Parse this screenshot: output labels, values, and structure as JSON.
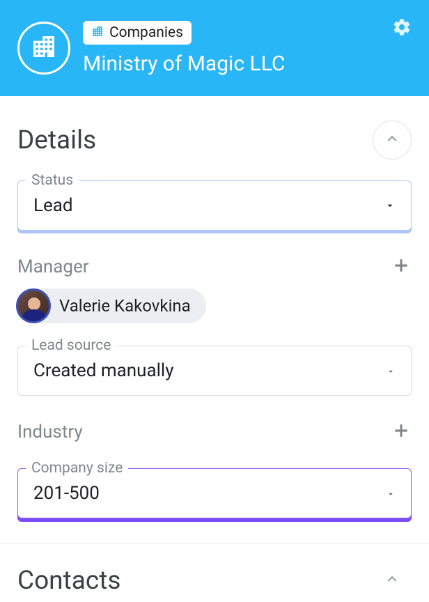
{
  "header": {
    "breadcrumb_label": "Companies",
    "company_name": "Ministry of Magic LLC"
  },
  "details": {
    "section_title": "Details",
    "status": {
      "label": "Status",
      "value": "Lead"
    },
    "manager": {
      "label": "Manager",
      "person_name": "Valerie Kakovkina"
    },
    "lead_source": {
      "label": "Lead source",
      "value": "Created manually"
    },
    "industry": {
      "label": "Industry"
    },
    "company_size": {
      "label": "Company size",
      "value": "201-500"
    }
  },
  "contacts": {
    "section_title": "Contacts"
  }
}
